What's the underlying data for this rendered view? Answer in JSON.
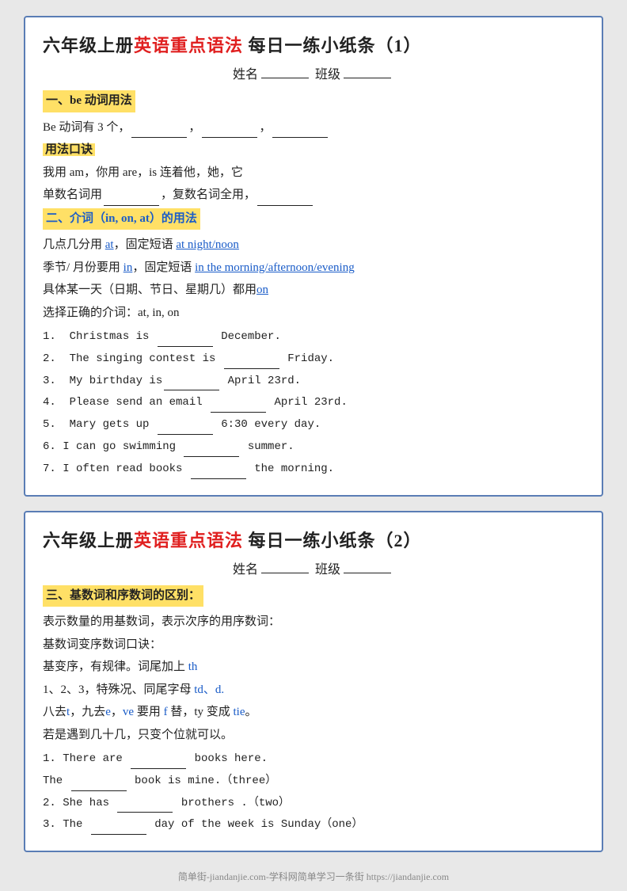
{
  "card1": {
    "title_black1": "六年级上册",
    "title_red": "英语重点语法",
    "title_black2": " 每日一练小纸条（1）",
    "name_label": "姓名",
    "class_label": "班级",
    "section1_header": "一、be 动词用法",
    "be_intro": "Be 动词有 3 个，",
    "usage_header": "用法口诀",
    "usage1": "我用 am，你用 are，is 连着他，她，它",
    "usage2_pre": "单数名词用",
    "usage2_mid": "，复数名词全用，",
    "section2_header": "二、介词（in, on, at）的用法",
    "prep1_pre": "几点几分用 ",
    "prep1_at": "at",
    "prep1_mid": "，固定短语 ",
    "prep1_link": "at night/noon",
    "prep2_pre": "季节/ 月份要用 ",
    "prep2_in": "in",
    "prep2_mid": "，固定短语 ",
    "prep2_link": "in the morning/afternoon/evening",
    "prep3_pre": "具体某一天（日期、节日、星期几）都用",
    "prep3_on": "on",
    "instruction": "选择正确的介词：at, in, on",
    "exercises": [
      {
        "num": "1.",
        "text": "Christmas is",
        "blank": true,
        "rest": "December."
      },
      {
        "num": "2.",
        "text": "The singing contest is",
        "blank": true,
        "rest": "Friday."
      },
      {
        "num": "3.",
        "text": "My birthday is",
        "blank": true,
        "rest": "April 23rd."
      },
      {
        "num": "4.",
        "text": "Please send an email",
        "blank": true,
        "rest": "April 23rd."
      },
      {
        "num": "5.",
        "text": "Mary gets up",
        "blank": true,
        "rest": "6:30 every day."
      },
      {
        "num": "6.",
        "text": "I can go swimming",
        "blank": true,
        "rest": "summer."
      },
      {
        "num": "7.",
        "text": "I often read books",
        "blank": true,
        "rest": "the morning."
      }
    ]
  },
  "card2": {
    "title_black1": "六年级上册",
    "title_red": "英语重点语法",
    "title_black2": " 每日一练小纸条（2）",
    "name_label": "姓名",
    "class_label": "班级",
    "section3_header": "三、基数词和序数词的区别：",
    "desc1": "表示数量的用基数词，表示次序的用序数词：",
    "desc2": "基数词变序数词口诀：",
    "desc3_pre": "基变序，有规律。词尾加上 ",
    "desc3_th": "th",
    "desc4_pre": "1、2、3，特殊况、同尾字母 ",
    "desc4_td": "td、d.",
    "desc5_pre": "八去",
    "desc5_t": "t",
    "desc5_mid1": "，九去",
    "desc5_e": "e",
    "desc5_mid2": "，",
    "desc5_ve": "ve",
    "desc5_mid3": " 要用 ",
    "desc5_f": "f",
    "desc5_mid4": " 替，ty 变成 ",
    "desc5_tie": "tie",
    "desc5_end": "。",
    "desc6": "若是遇到几十几，只变个位就可以。",
    "exercises": [
      {
        "num": "1.",
        "text": "There are",
        "blank": true,
        "rest": "books here."
      },
      {
        "num": "",
        "text": "The",
        "blank": true,
        "rest": "book is mine.（three）"
      },
      {
        "num": "2.",
        "text": "She has",
        "blank": true,
        "rest": "brothers .（two）"
      },
      {
        "num": "3.",
        "text": "The",
        "blank": true,
        "rest": "day of the week is Sunday（one）"
      }
    ]
  },
  "footer": {
    "text": "简单街-jiandanjie.com-学科网简单学习一条街 https://jiandanjie.com"
  }
}
